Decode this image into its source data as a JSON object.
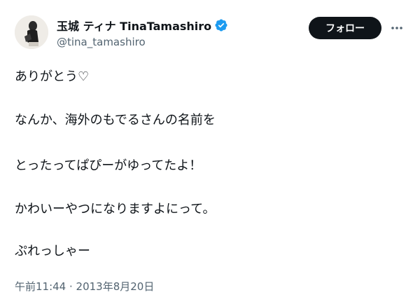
{
  "author": {
    "display_name": "玉城 ティナ TinaTamashiro",
    "handle": "@tina_tamashiro",
    "verified": true,
    "verified_color": "#1d9bf0"
  },
  "actions": {
    "follow_label": "フォロー",
    "more_icon": "more-horizontal-icon"
  },
  "tweet": {
    "lines": [
      "ありがとう♡",
      "なんか、海外のもでるさんの名前を",
      "とったってぱぴーがゆってたよ！",
      "かわいーやつになりますよにって。",
      "ぷれっしゃー"
    ],
    "timestamp": "午前11:44 · 2013年8月20日"
  }
}
